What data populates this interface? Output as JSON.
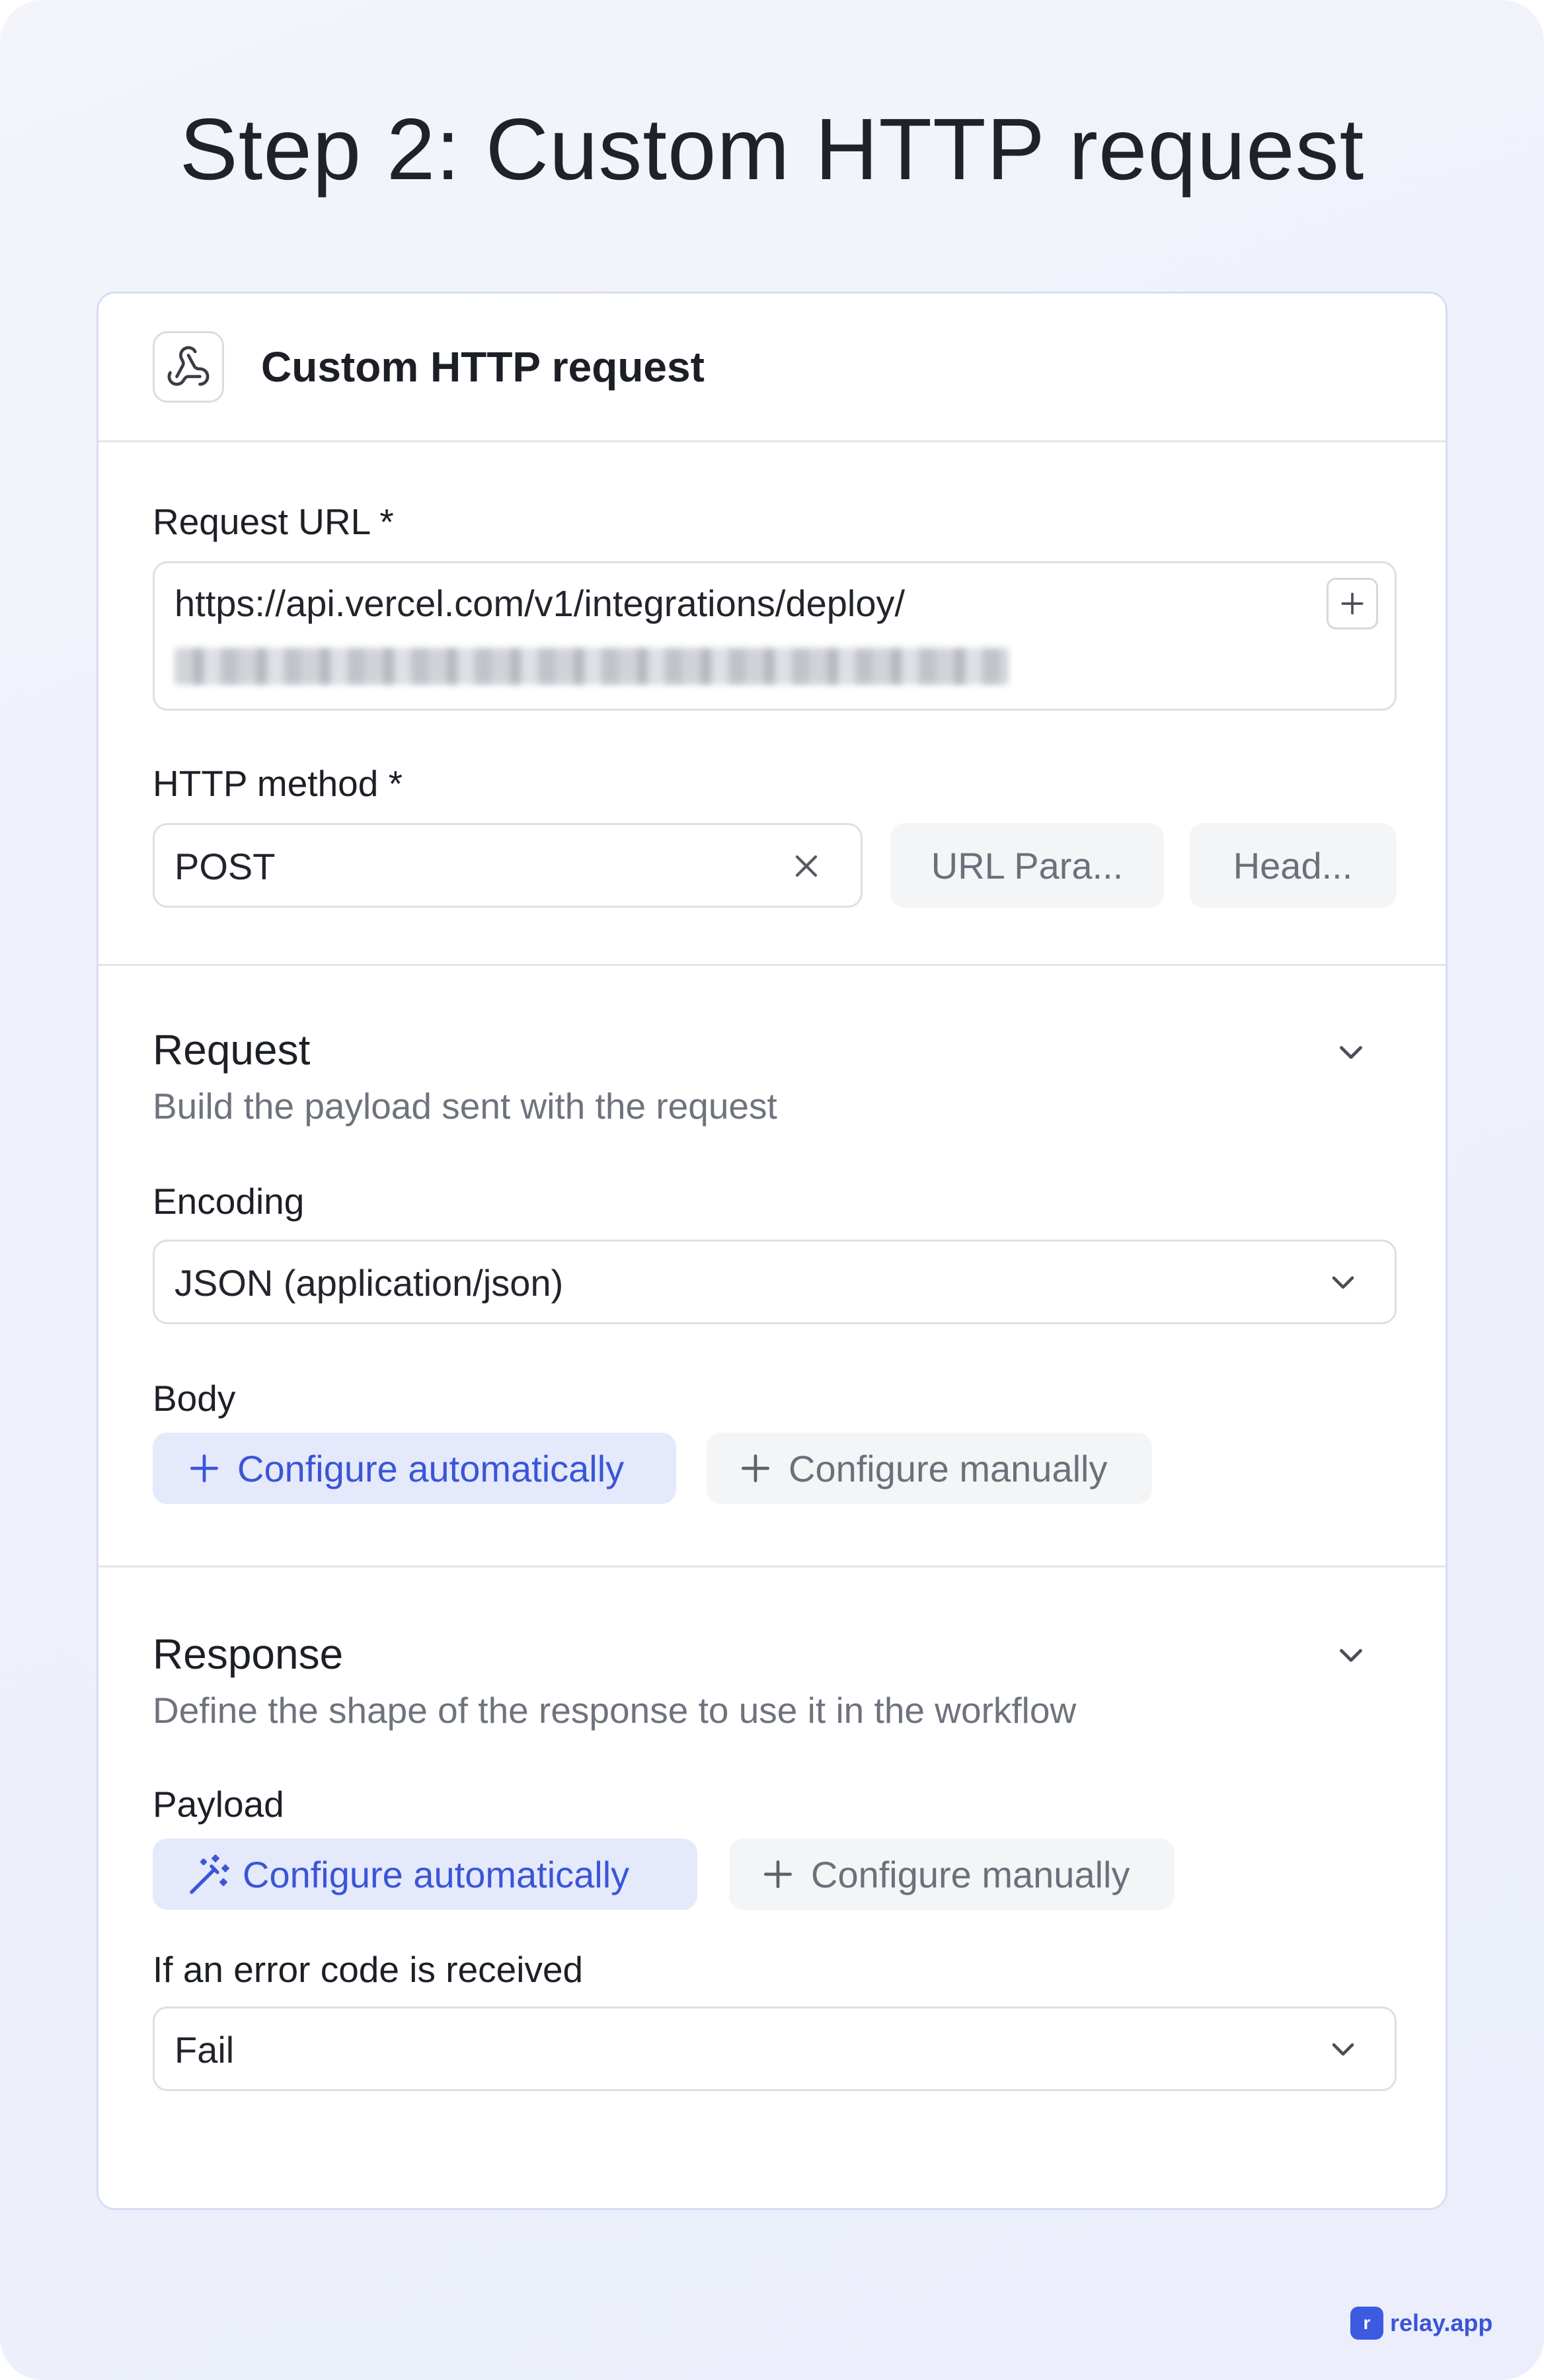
{
  "page": {
    "title": "Step 2: Custom HTTP request"
  },
  "card": {
    "icon": "webhook-icon",
    "title": "Custom HTTP request"
  },
  "request_url": {
    "label": "Request URL *",
    "value_line1": "https://api.vercel.com/v1/integrations/deploy/",
    "add_icon": "plus-icon"
  },
  "http_method": {
    "label": "HTTP method *",
    "value": "POST",
    "clear_icon": "close-icon",
    "url_params_button": "URL Para...",
    "headers_button": "Head..."
  },
  "request_section": {
    "title": "Request",
    "subtitle": "Build the payload sent with the request",
    "encoding_label": "Encoding",
    "encoding_value": "JSON (application/json)",
    "body_label": "Body",
    "configure_auto": "Configure automatically",
    "configure_manual": "Configure manually"
  },
  "response_section": {
    "title": "Response",
    "subtitle": "Define the shape of the response to use it in the workflow",
    "payload_label": "Payload",
    "configure_auto": "Configure automatically",
    "configure_manual": "Configure manually",
    "error_label": "If an error code is received",
    "error_value": "Fail"
  },
  "brand": {
    "name": "relay.app",
    "logo_glyph": "r"
  },
  "colors": {
    "accent": "#3a55d6",
    "accent_bg": "#e4e9fc",
    "card_border": "#d6dcf6"
  }
}
